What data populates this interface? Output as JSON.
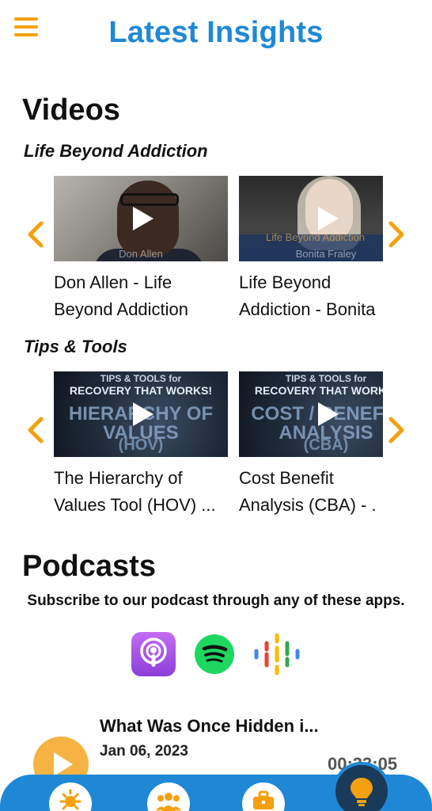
{
  "header": {
    "title": "Latest Insights",
    "menu_icon": "hamburger-menu-icon"
  },
  "videos": {
    "section_title": "Videos",
    "categories": [
      {
        "title": "Life Beyond Addiction",
        "items": [
          {
            "title_line1": "Don Allen - Life",
            "title_line2": "Beyond Addiction",
            "thumb_caption": "Don Allen"
          },
          {
            "title_line1": "Life Beyond",
            "title_line2": "Addiction - Bonita",
            "thumb_caption": "Bonita Fraley",
            "thumb_banner": "Life Beyond Addiction"
          }
        ]
      },
      {
        "title": "Tips & Tools",
        "items": [
          {
            "title_line1": "The Hierarchy of",
            "title_line2": "Values Tool (HOV) ...",
            "thumb_top": "TIPS & TOOLS for",
            "thumb_sub": "RECOVERY THAT WORKS!",
            "thumb_big": "HIERARCHY OF VALUES",
            "thumb_paren": "(HOV)"
          },
          {
            "title_line1": "Cost Benefit",
            "title_line2": "Analysis (CBA) - .",
            "thumb_top": "TIPS & TOOLS for",
            "thumb_sub": "RECOVERY THAT WORKS!",
            "thumb_big": "COST / BENEFIT ANALYSIS",
            "thumb_paren": "(CBA)"
          }
        ]
      }
    ]
  },
  "podcasts": {
    "section_title": "Podcasts",
    "subtitle": "Subscribe to our podcast through any of these apps.",
    "apps": [
      "apple-podcasts-icon",
      "spotify-icon",
      "google-podcasts-icon"
    ],
    "episode": {
      "title": "What Was Once Hidden i...",
      "date": "Jan 06, 2023",
      "duration": "00:33:05"
    }
  },
  "tabbar": {
    "tabs": [
      "sun-gear-icon",
      "group-icon",
      "briefcase-icon",
      "lightbulb-icon"
    ],
    "active_tab": "lightbulb-icon"
  },
  "colors": {
    "accent_blue": "#1f88d6",
    "accent_orange": "#f5a00f"
  }
}
